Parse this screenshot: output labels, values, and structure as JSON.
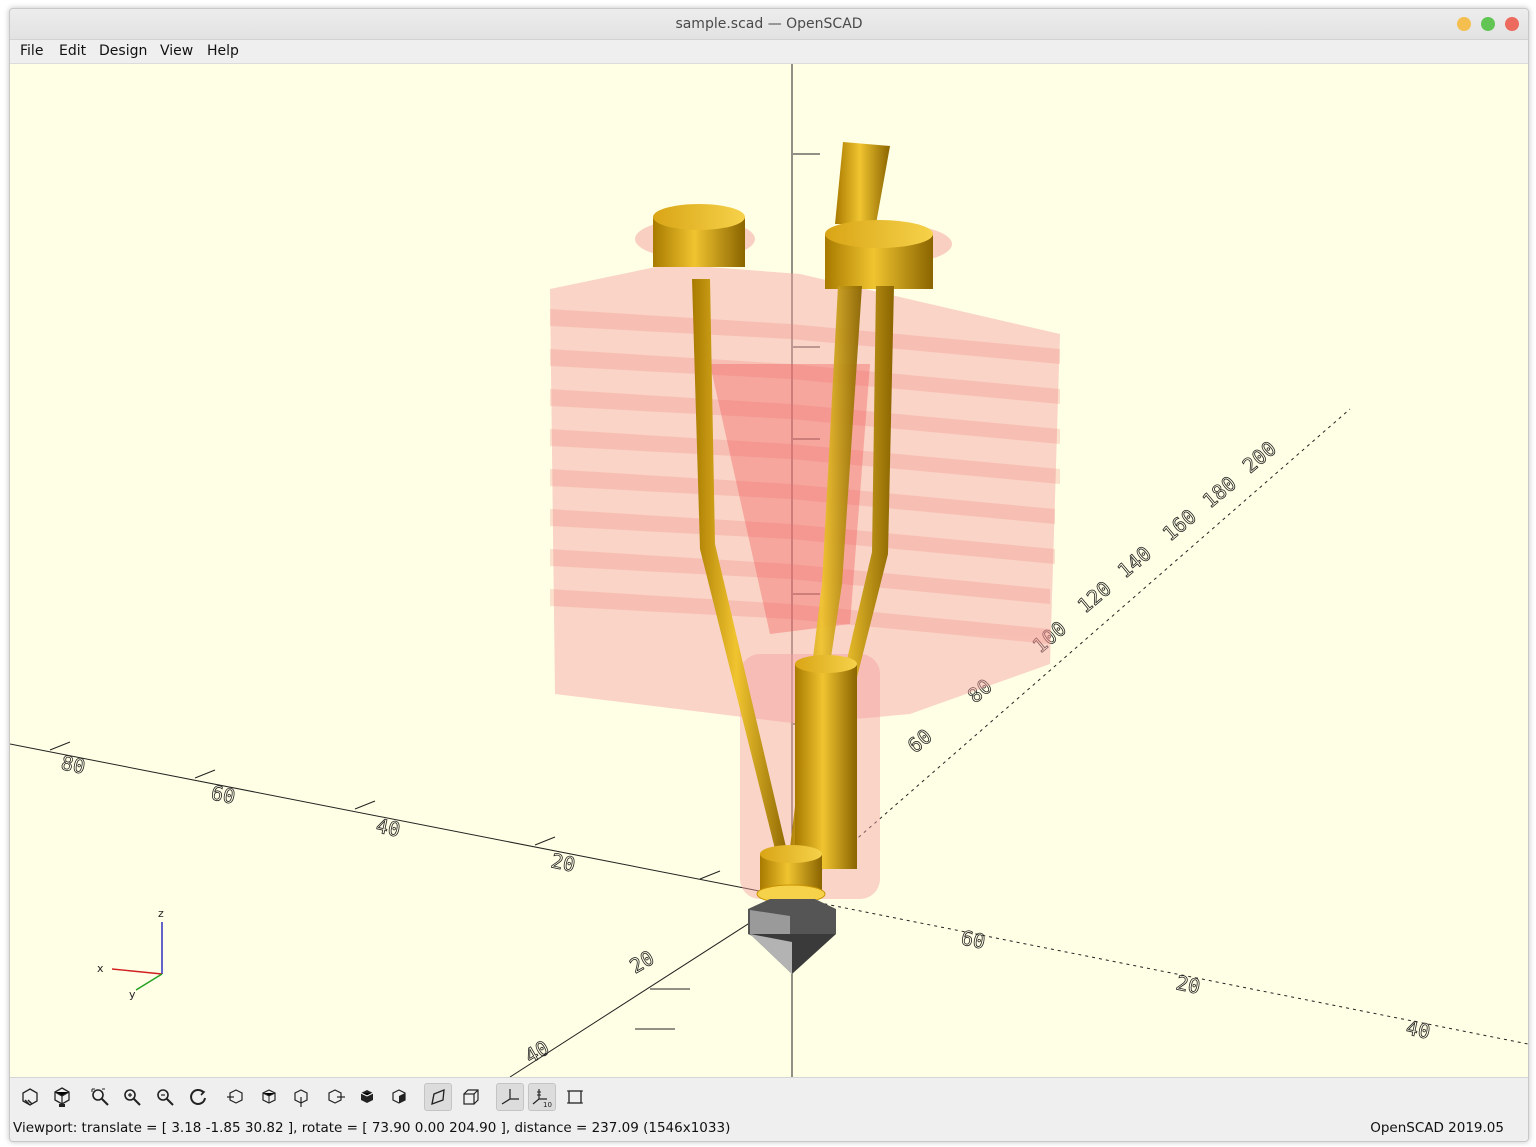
{
  "window": {
    "title": "sample.scad — OpenSCAD",
    "controls": {
      "minimize_color": "#f5bf4f",
      "maximize_color": "#61c554",
      "close_color": "#ed6a5e"
    }
  },
  "menu": [
    "File",
    "Edit",
    "Design",
    "View",
    "Help"
  ],
  "viewport": {
    "background": "#ffffe5",
    "axis_labels": [
      "80",
      "60",
      "40",
      "20",
      "20",
      "40",
      "60",
      "20",
      "40",
      "60",
      "80",
      "100",
      "120",
      "140",
      "160",
      "180",
      "200"
    ],
    "gizmo": {
      "x": "x",
      "y": "y",
      "z": "z"
    },
    "colors": {
      "model": "#e6b319",
      "heatsink": "#f08a8a",
      "nozzle": "#9a9a9a"
    }
  },
  "toolbar": [
    "preview-icon",
    "render-icon",
    "view-all-icon",
    "zoom-in-icon",
    "zoom-out-icon",
    "reset-view-icon",
    "view-right-icon",
    "view-top-icon",
    "view-bottom-icon",
    "view-left-icon",
    "view-front-icon",
    "view-back-icon",
    "perspective-icon",
    "orthogonal-icon",
    "show-axes-icon",
    "show-scale-markers-icon",
    "show-edges-icon"
  ],
  "statusbar": {
    "viewport_info": "Viewport: translate = [ 3.18 -1.85 30.82 ], rotate = [ 73.90 0.00 204.90 ], distance = 237.09 (1546x1033)",
    "version": "OpenSCAD 2019.05"
  }
}
